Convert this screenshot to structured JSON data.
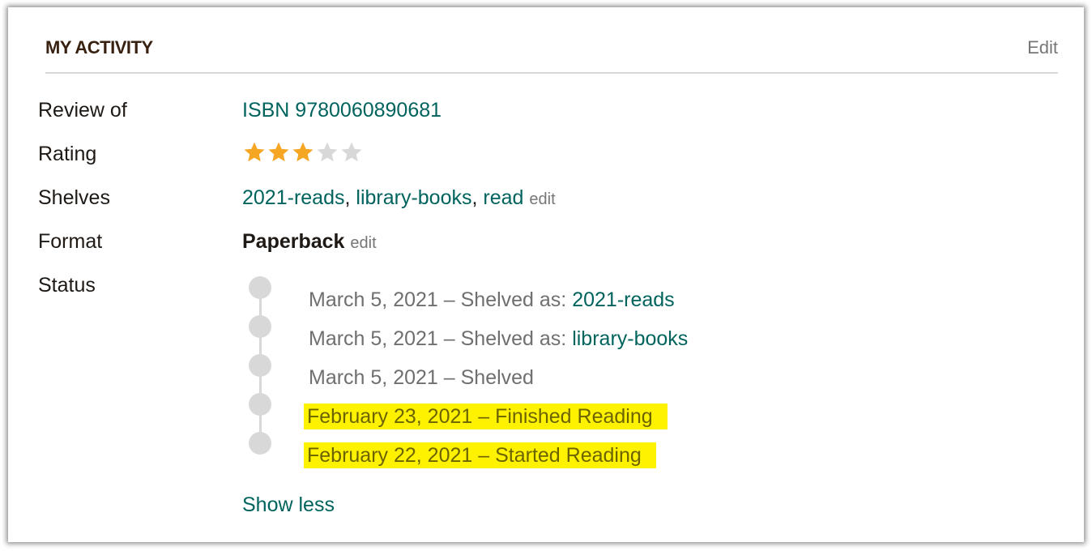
{
  "header": {
    "title": "MY ACTIVITY",
    "edit_label": "Edit"
  },
  "details": {
    "review_of": {
      "label": "Review of",
      "value": "ISBN 9780060890681"
    },
    "rating": {
      "label": "Rating",
      "value": 3,
      "max": 5,
      "filled_color": "#f5a623",
      "empty_color": "#d8d8d8"
    },
    "shelves": {
      "label": "Shelves",
      "items": [
        "2021-reads",
        "library-books",
        "read"
      ],
      "separator": ", ",
      "edit_label": "edit"
    },
    "format": {
      "label": "Format",
      "value": "Paperback",
      "edit_label": "edit"
    },
    "status": {
      "label": "Status"
    }
  },
  "timeline": [
    {
      "date": "March 5, 2021",
      "action": "Shelved as: ",
      "link": "2021-reads",
      "highlighted": false
    },
    {
      "date": "March 5, 2021",
      "action": "Shelved as: ",
      "link": "library-books",
      "highlighted": false
    },
    {
      "date": "March 5, 2021",
      "action": "Shelved",
      "link": "",
      "highlighted": false
    },
    {
      "date": "February 23, 2021",
      "action": "Finished Reading",
      "link": "",
      "highlighted": true
    },
    {
      "date": "February 22, 2021",
      "action": "Started Reading",
      "link": "",
      "highlighted": true
    }
  ],
  "timeline_separator": " – ",
  "show_less_label": "Show less",
  "colors": {
    "link": "#00635d",
    "heading": "#382110",
    "muted": "#767676",
    "highlight": "#fff200"
  }
}
